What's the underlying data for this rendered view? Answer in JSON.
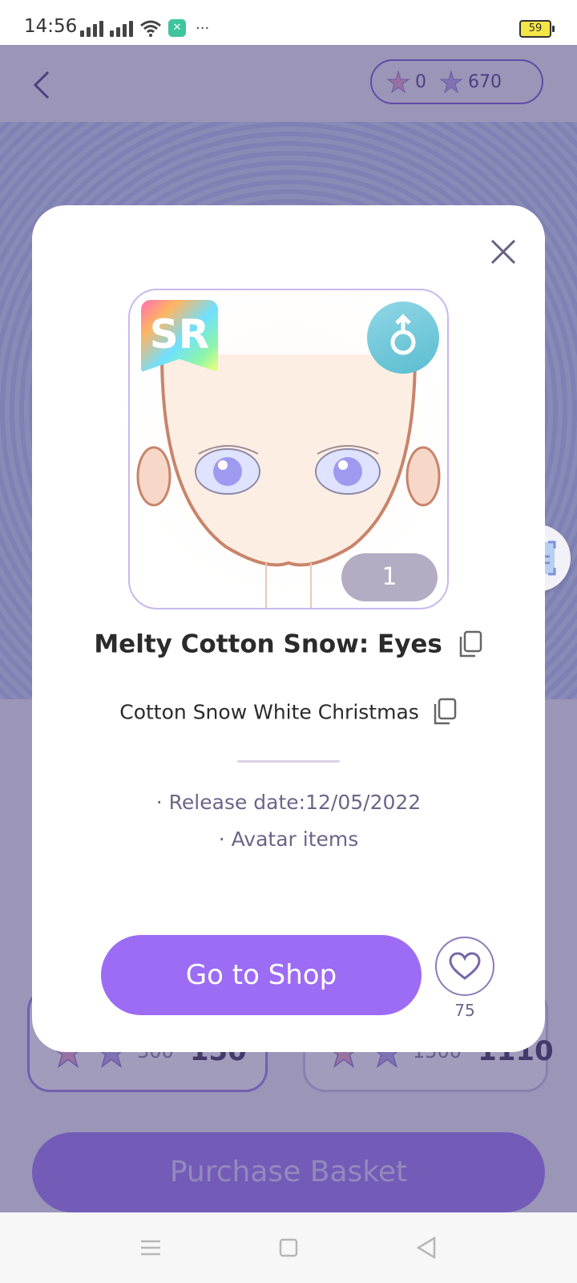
{
  "status_bar": {
    "time": "14:56",
    "battery_level": "59",
    "more_indicator": "···"
  },
  "header": {
    "currency_a": "0",
    "currency_b": "670"
  },
  "price_cards": [
    {
      "old_price": "300",
      "new_price": "150"
    },
    {
      "old_price": "1500",
      "new_price": "1110"
    }
  ],
  "purchase_button_label": "Purchase Basket",
  "modal": {
    "badge_rarity": "SR",
    "gender_symbol": "male-icon",
    "count": "1",
    "item_title": "Melty Cotton Snow: Eyes",
    "collection_name": "Cotton Snow White Christmas",
    "release_date": "· Release date:12/05/2022",
    "category": "· Avatar items",
    "shop_button_label": "Go to Shop",
    "favorite_count": "75"
  },
  "colors": {
    "accent": "#9d6cf5",
    "overlay": "#3c326e",
    "modal_bg": "#ffffff",
    "count_badge": "#b3adc4"
  }
}
